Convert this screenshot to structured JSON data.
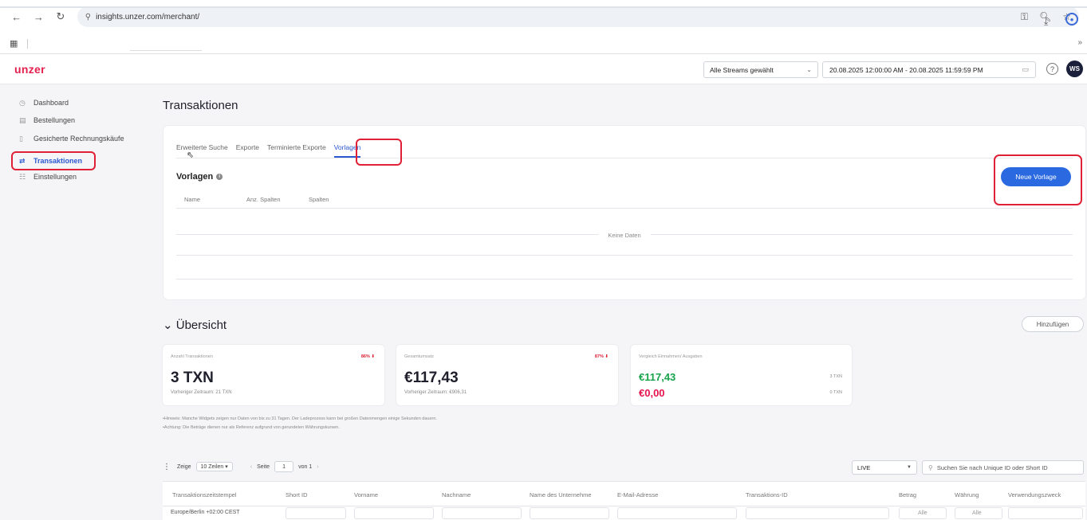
{
  "browser": {
    "url": "insights.unzer.com/merchant/"
  },
  "header": {
    "logo": "unzer",
    "stream_select": "Alle Streams gewählt",
    "date_range": "20.08.2025 12:00:00 AM - 20.08.2025 11:59:59 PM",
    "avatar": "WS"
  },
  "sidebar": {
    "items": [
      {
        "label": "Dashboard",
        "icon": "clock-icon"
      },
      {
        "label": "Bestellungen",
        "icon": "document-icon"
      },
      {
        "label": "Gesicherte Rechnungskäufe",
        "icon": "invoice-icon"
      },
      {
        "label": "Transaktionen",
        "icon": "transfer-icon"
      },
      {
        "label": "Einstellungen",
        "icon": "settings-icon"
      }
    ]
  },
  "main": {
    "page_title": "Transaktionen",
    "tabs": [
      "Erweiterte Suche",
      "Exporte",
      "Terminierte Exporte",
      "Vorlagen"
    ],
    "section_title": "Vorlagen",
    "new_template_button": "Neue Vorlage",
    "columns": [
      "Name",
      "Anz. Spalten",
      "Spalten"
    ],
    "empty_text": "Keine Daten"
  },
  "overview": {
    "title": "Übersicht",
    "add_button": "Hinzufügen",
    "kpis": [
      {
        "label": "Anzahl Transaktionen",
        "badge": "86% ⬇",
        "value": "3 TXN",
        "sub": "Vorheriger Zeitraum: 21 TXN"
      },
      {
        "label": "Gesamtumsatz",
        "badge": "87% ⬇",
        "value": "€117,43",
        "sub": "Vorheriger Zeitraum: €906,31"
      },
      {
        "label": "Vergleich Einnahmen/ Ausgaben",
        "income": "€117,43",
        "income_txn": "3 TXN",
        "expense": "€0,00",
        "expense_txn": "0 TXN"
      }
    ],
    "notes": [
      "•Hinweis: Manche Widgets zeigen nur Daten von bis zu 31 Tagen. Der Ladeprozess kann bei großen Datenmengen einige Sekunden dauern.",
      "•Achtung: Die Beträge dienen nur als Referenz aufgrund von gerundeten Währungskursen."
    ]
  },
  "pager": {
    "show_label": "Zeige",
    "rows": "10 Zeilen ▾",
    "page_label": "Seite",
    "page": "1",
    "of_label": "von 1"
  },
  "filters": {
    "mode": "LIVE",
    "search_placeholder": "Suchen Sie nach Unique ID oder Short ID"
  },
  "transactions_table": {
    "columns": [
      "Transaktionszeitstempel",
      "Short ID",
      "Vorname",
      "Nachname",
      "Name des Unternehme",
      "E-Mail-Adresse",
      "Transaktions-ID",
      "Betrag",
      "Währung",
      "Verwendungszweck"
    ],
    "timezone": "Europe/Berlin +02:00 CEST",
    "filter_all": "Alle"
  }
}
